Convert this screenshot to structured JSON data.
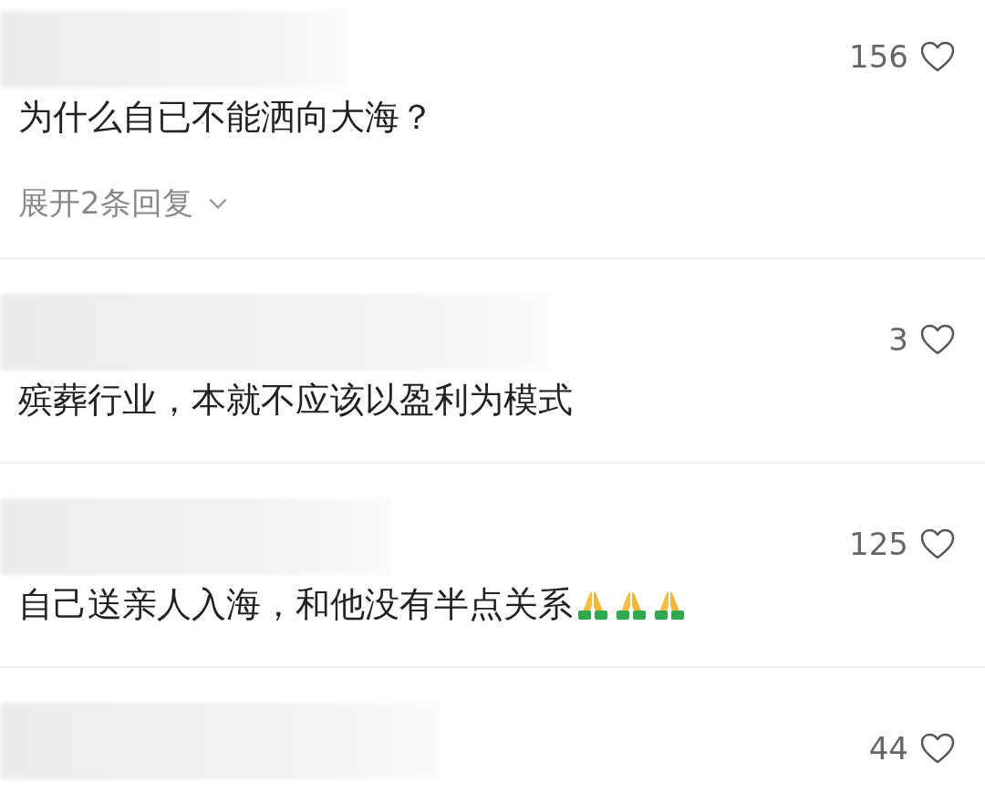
{
  "comments": [
    {
      "author": {
        "kind": "redacted"
      },
      "likes": "156",
      "liked": false,
      "text": "为什么自已不能洒向大海？",
      "replies": {
        "label": "展开2条回复",
        "expanded": false
      }
    },
    {
      "author": {
        "kind": "redacted"
      },
      "likes": "3",
      "liked": false,
      "text": "殡葬行业，本就不应该以盈利为模式"
    },
    {
      "author": {
        "kind": "redacted"
      },
      "likes": "125",
      "liked": false,
      "text": "自己送亲人入海，和他没有半点关系",
      "icons": [
        {
          "kind": "praying-hands"
        },
        {
          "kind": "praying-hands"
        },
        {
          "kind": "praying-hands"
        }
      ]
    },
    {
      "author": {
        "kind": "redacted"
      },
      "likes": "44",
      "liked": false
    }
  ]
}
